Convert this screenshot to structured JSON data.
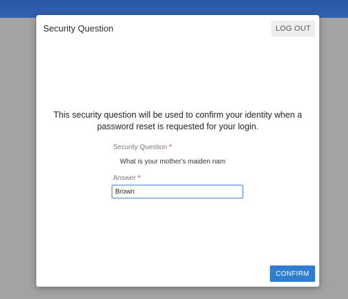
{
  "dialog": {
    "title": "Security Question",
    "logout_label": "LOG OUT",
    "intro_text": "This security question will be used to confirm your identity when a password reset is requested for your login.",
    "question_label": "Security Question",
    "question_value": "What is your mother's maiden nam",
    "answer_label": "Answer",
    "required_marker": "*",
    "answer_value": "Brown",
    "confirm_label": "CONFIRM"
  },
  "colors": {
    "top_bar": "#2d5aa8",
    "backdrop": "#a3a3a3",
    "confirm_button": "#2f7fd0",
    "input_focus_border": "#3d7fd6",
    "required": "#d32f2f"
  }
}
